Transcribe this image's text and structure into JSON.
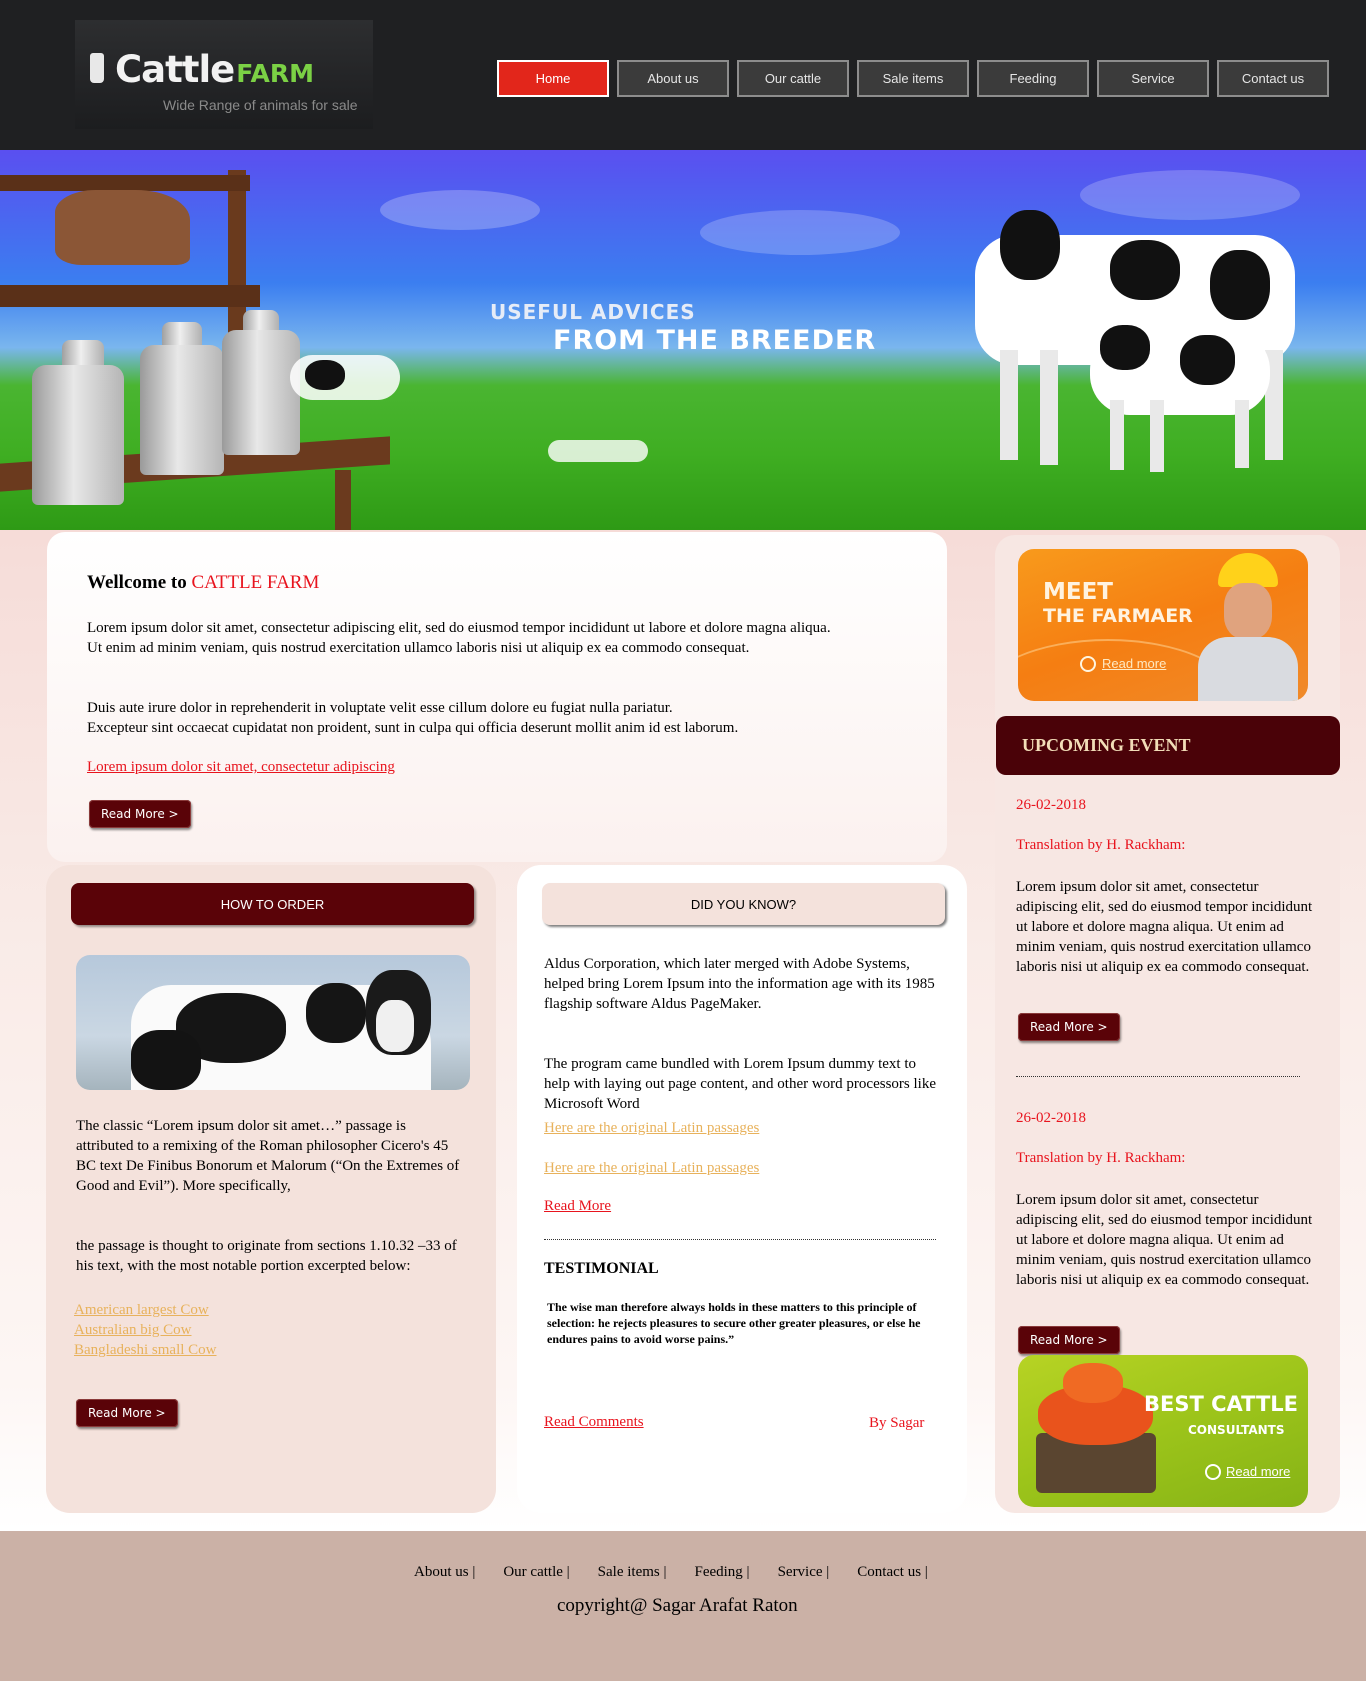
{
  "logo": {
    "title_main": "Cattle",
    "title_accent": "FARM",
    "tagline": "Wide Range of animals for sale"
  },
  "nav": [
    {
      "label": "Home",
      "active": true
    },
    {
      "label": "About us"
    },
    {
      "label": "Our cattle"
    },
    {
      "label": "Sale items"
    },
    {
      "label": "Feeding"
    },
    {
      "label": "Service"
    },
    {
      "label": "Contact us"
    }
  ],
  "banner": {
    "line1": "USEFUL ADVICES",
    "line2": "FROM THE BREEDER"
  },
  "welcome": {
    "title_prefix": "Wellcome to",
    "title_brand": "CATTLE FARM",
    "para1_line1": "Lorem ipsum dolor sit amet, consectetur adipiscing elit, sed do eiusmod tempor incididunt ut labore et dolore magna aliqua.",
    "para1_line2": "Ut enim ad minim veniam, quis nostrud exercitation ullamco laboris nisi ut aliquip ex ea commodo consequat.",
    "para2_line1": "Duis aute irure dolor in reprehenderit in voluptate velit esse cillum dolore eu fugiat nulla pariatur.",
    "para2_line2": "Excepteur sint occaecat cupidatat non proident, sunt in culpa qui officia deserunt mollit anim id est laborum.",
    "link": "Lorem ipsum dolor sit amet, consectetur adipiscing",
    "button": "Read More >"
  },
  "order": {
    "header": "HOW TO ORDER",
    "para1": "The classic “Lorem ipsum dolor sit amet…” passage is attributed to a remixing of the Roman philosopher Cicero's 45 BC text De Finibus Bonorum et Malorum (“On the Extremes of Good and Evil”). More specifically,",
    "para2": "the passage is thought to originate from sections 1.10.32 –33 of his text, with the most notable portion excerpted below:",
    "links": [
      "American largest Cow",
      "Australian big Cow",
      "Bangladeshi small Cow"
    ],
    "button": "Read More >"
  },
  "know": {
    "header": "DID YOU KNOW?",
    "para1": "Aldus Corporation, which later merged with Adobe Systems, helped bring Lorem Ipsum into the information age with its 1985 flagship software Aldus PageMaker.",
    "para2": "The program came bundled with Lorem Ipsum dummy text to help with laying out page content, and other word processors like Microsoft Word",
    "link1": "Here are the original Latin passages",
    "link2": "Here are the original Latin passages",
    "read_more": "Read More",
    "testimonial_title": "TESTIMONIAL",
    "testimonial_quote": "The wise man therefore always holds in these matters to this principle of selection: he rejects pleasures to secure other greater pleasures, or else he endures pains to avoid worse pains.”",
    "read_comments": "Read Comments",
    "by": "By Sagar"
  },
  "sidebar": {
    "promo_meet_line1": "MEET",
    "promo_meet_line2": "THE FARMAER",
    "promo_meet_link": "Read more",
    "event_header": "UPCOMING EVENT",
    "events": [
      {
        "date": "26-02-2018",
        "title": "Translation by H. Rackham:",
        "text": "Lorem ipsum dolor sit amet, consectetur adipiscing elit, sed do eiusmod tempor incididunt ut labore et dolore magna aliqua. Ut enim ad minim veniam, quis nostrud exercitation ullamco laboris nisi ut aliquip ex ea commodo consequat.",
        "button": "Read More >"
      },
      {
        "date": "26-02-2018",
        "title": "Translation by H. Rackham:",
        "text": "Lorem ipsum dolor sit amet, consectetur adipiscing elit, sed do eiusmod tempor incididunt ut labore et dolore magna aliqua. Ut enim ad minim veniam, quis nostrud exercitation ullamco laboris nisi ut aliquip ex ea commodo consequat.",
        "button": "Read More >"
      }
    ],
    "promo_best_line1": "BEST CATTLE",
    "promo_best_line2": "CONSULTANTS",
    "promo_best_link": "Read more"
  },
  "footer": {
    "links": [
      "About us |",
      "Our cattle |",
      "Sale items |",
      "Feeding |",
      "Service |",
      "Contact us |"
    ],
    "copyright": "copyright@ Sagar Arafat Raton"
  },
  "colors": {
    "header_bg": "#1f2022",
    "nav_active": "#e2261b",
    "maroon": "#5a0308",
    "accent_red": "#e8141e",
    "link_gold": "#e8b25c",
    "footer_bg": "#cbb1a6"
  }
}
